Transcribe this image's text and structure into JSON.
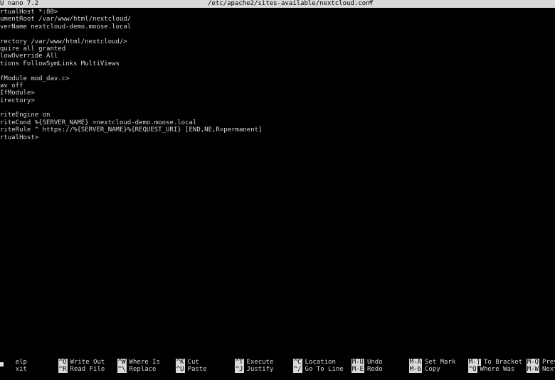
{
  "titlebar": {
    "app": "U nano 7.2",
    "filename": "/etc/apache2/sites-available/nextcloud.conf",
    "modified": "*"
  },
  "lines": [
    "rtualHost *:80>",
    "umentRoot /var/www/html/nextcloud/",
    "verName nextcloud-demo.moose.local",
    "",
    "rectory /var/www/html/nextcloud/>",
    "quire all granted",
    "lowOverride All",
    "tions FollowSymLinks MultiViews",
    "",
    "fModule mod_dav.c>",
    "av off",
    "IfModule>",
    "irectory>",
    "",
    "riteEngine on",
    "riteCond %{SERVER_NAME} =nextcloud-demo.moose.local",
    "riteRule ^ https://%{SERVER_NAME}%{REQUEST_URI} [END,NE,R=permanent]",
    "rtualHost>"
  ],
  "shortcuts": {
    "row1": [
      {
        "key": "",
        "label": "elp"
      },
      {
        "key": "^O",
        "label": "Write Out"
      },
      {
        "key": "^W",
        "label": "Where Is"
      },
      {
        "key": "^K",
        "label": "Cut"
      },
      {
        "key": "^T",
        "label": "Execute"
      },
      {
        "key": "^C",
        "label": "Location"
      },
      {
        "key": "M-U",
        "label": "Undo"
      },
      {
        "key": "M-A",
        "label": "Set Mark"
      },
      {
        "key": "M-]",
        "label": "To Bracket"
      },
      {
        "key": "M-Q",
        "label": "Previous"
      }
    ],
    "row2": [
      {
        "key": "",
        "label": "xit"
      },
      {
        "key": "^R",
        "label": "Read File"
      },
      {
        "key": "^\\",
        "label": "Replace"
      },
      {
        "key": "^U",
        "label": "Paste"
      },
      {
        "key": "^J",
        "label": "Justify"
      },
      {
        "key": "^/",
        "label": "Go To Line"
      },
      {
        "key": "M-E",
        "label": "Redo"
      },
      {
        "key": "M-6",
        "label": "Copy"
      },
      {
        "key": "^Q",
        "label": "Where Was"
      },
      {
        "key": "M-W",
        "label": "Next"
      }
    ]
  }
}
